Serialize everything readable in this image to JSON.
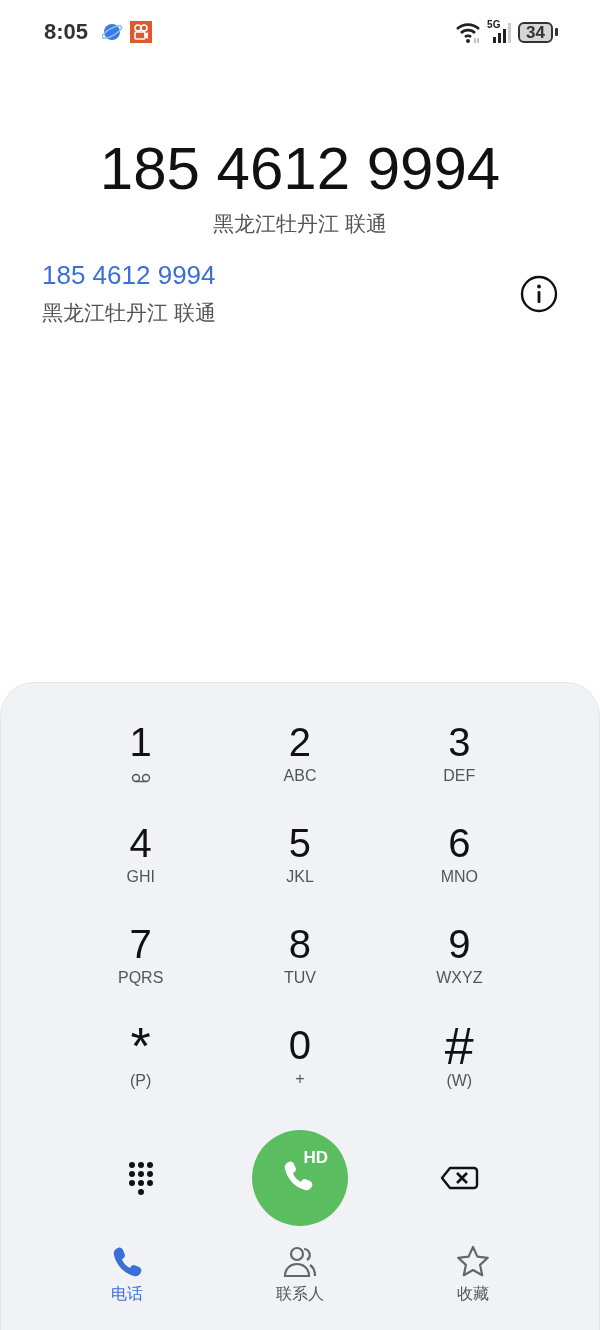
{
  "status_bar": {
    "time": "8:05",
    "network": "5G",
    "battery": "34"
  },
  "dialed": {
    "number": "185 4612 9994",
    "location": "黑龙江牡丹江 联通"
  },
  "suggestion": {
    "number": "185 4612 9994",
    "location": "黑龙江牡丹江 联通"
  },
  "keypad": [
    {
      "digit": "1",
      "kind": "voicemail"
    },
    {
      "digit": "2",
      "kind": "letters",
      "letters": "ABC"
    },
    {
      "digit": "3",
      "kind": "letters",
      "letters": "DEF"
    },
    {
      "digit": "4",
      "kind": "letters",
      "letters": "GHI"
    },
    {
      "digit": "5",
      "kind": "letters",
      "letters": "JKL"
    },
    {
      "digit": "6",
      "kind": "letters",
      "letters": "MNO"
    },
    {
      "digit": "7",
      "kind": "letters",
      "letters": "PQRS"
    },
    {
      "digit": "8",
      "kind": "letters",
      "letters": "TUV"
    },
    {
      "digit": "9",
      "kind": "letters",
      "letters": "WXYZ"
    },
    {
      "digit": "*",
      "kind": "letters",
      "letters": "(P)"
    },
    {
      "digit": "0",
      "kind": "letters",
      "letters": "+"
    },
    {
      "digit": "#",
      "kind": "letters",
      "letters": "(W)"
    }
  ],
  "call_button": {
    "badge": "HD"
  },
  "nav": [
    {
      "label": "电话",
      "kind": "phone",
      "selected": true
    },
    {
      "label": "联系人",
      "kind": "contacts",
      "selected": false
    },
    {
      "label": "收藏",
      "kind": "favorites",
      "selected": false
    }
  ]
}
